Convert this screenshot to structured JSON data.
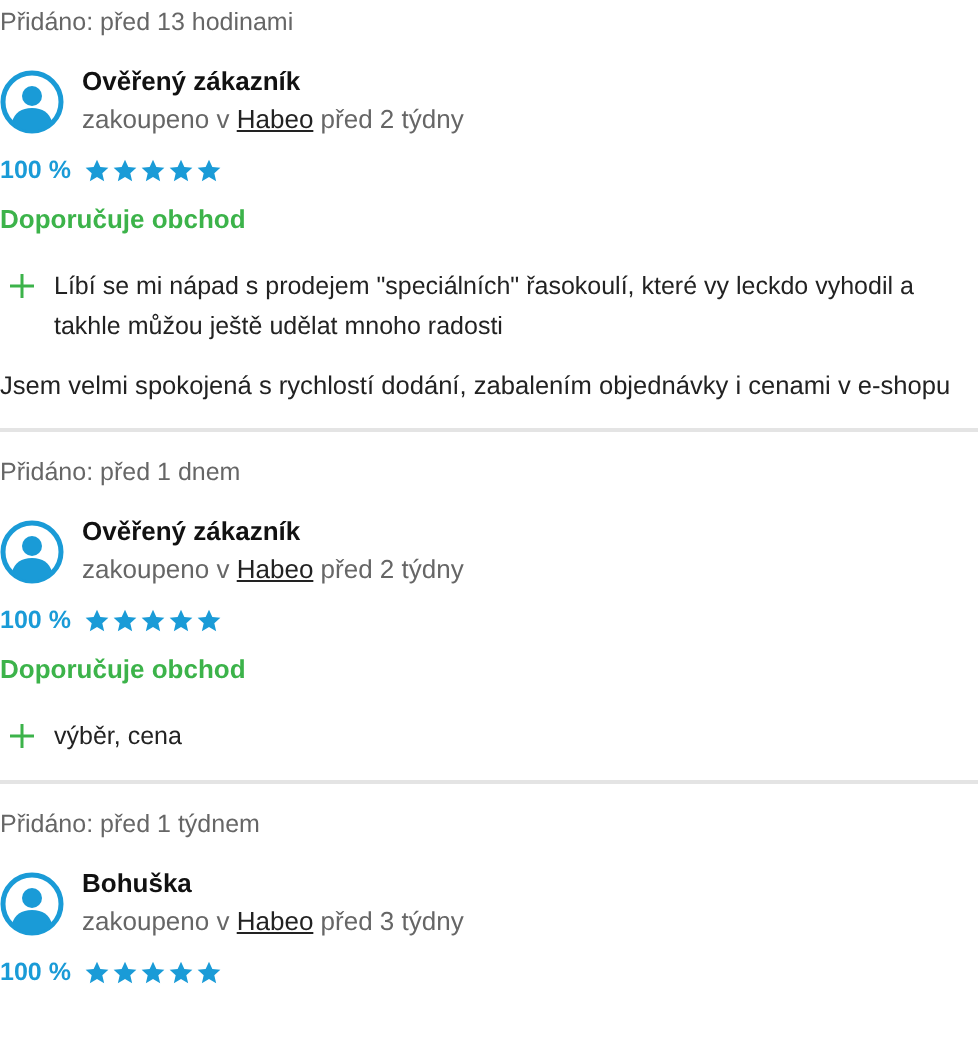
{
  "reviews": [
    {
      "added": "Přidáno: před 13 hodinami",
      "author": "Ověřený zákazník",
      "purchase_prefix": "zakoupeno v",
      "shop": "Habeo",
      "purchased_when": "před 2 týdny",
      "rating": "100 %",
      "stars": 5,
      "recommendation": "Doporučuje obchod",
      "pros": [
        "Líbí se mi nápad s prodejem \"speciálních\" řasokoulí, které vy leckdo vyhodil a takhle můžou ještě udělat mnoho radosti"
      ],
      "comment": "Jsem velmi spokojená s rychlostí dodání, zabalením objednávky i cenami v e-shopu"
    },
    {
      "added": "Přidáno: před 1 dnem",
      "author": "Ověřený zákazník",
      "purchase_prefix": "zakoupeno v",
      "shop": "Habeo",
      "purchased_when": "před 2 týdny",
      "rating": "100 %",
      "stars": 5,
      "recommendation": "Doporučuje obchod",
      "pros": [
        "výběr, cena"
      ]
    },
    {
      "added": "Přidáno: před 1 týdnem",
      "author": "Bohuška",
      "purchase_prefix": "zakoupeno v",
      "shop": "Habeo",
      "purchased_when": "před 3 týdny",
      "rating": "100 %",
      "stars": 5
    }
  ]
}
